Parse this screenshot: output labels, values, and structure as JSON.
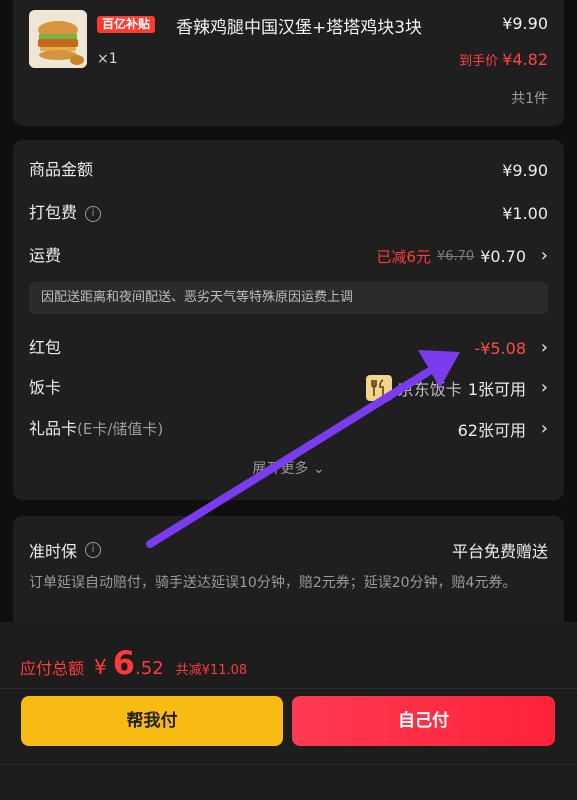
{
  "product": {
    "subsidy_badge": "百亿补贴",
    "title": "香辣鸡腿中国汉堡+塔塔鸡块3块",
    "price": "¥9.90",
    "quantity": "×1",
    "net_price_label": "到手价",
    "net_price": "¥4.82",
    "item_count": "共1件"
  },
  "fees": {
    "goods_amount": {
      "label": "商品金额",
      "value": "¥9.90"
    },
    "packing_fee": {
      "label": "打包费",
      "value": "¥1.00",
      "icon": "info-icon"
    },
    "delivery_fee": {
      "label": "运费",
      "reduced": "已减6元",
      "original": "¥6.70",
      "value": "¥0.70"
    },
    "delivery_notice": "因配送距离和夜间配送、恶劣天气等特殊原因运费上调",
    "red_packet": {
      "label": "红包",
      "value": "-¥5.08"
    },
    "meal_card": {
      "label": "饭卡",
      "name": "京东饭卡",
      "value": "1张可用",
      "icon": "fork-knife-icon"
    },
    "gift_card": {
      "label": "礼品卡",
      "sub_label": "(E卡/储值卡)",
      "value": "62张可用"
    },
    "expand_more": "展开更多"
  },
  "punctual": {
    "title": "准时保",
    "right": "平台免费赠送",
    "description": "订单延误自动赔付，骑手送达延误10分钟，赔2元券；延误20分钟，赔4元券。"
  },
  "bottom_bar": {
    "total_label": "应付总额",
    "currency": "¥",
    "total_integer": "6",
    "total_decimal": ".52",
    "total_discount": "共减¥11.08",
    "help_pay_button": "帮我付",
    "self_pay_button": "自己付"
  },
  "colors": {
    "accent_red": "#ff3a3a",
    "help_button": "#f8bb13",
    "annotation_arrow": "#7b3cf0"
  }
}
